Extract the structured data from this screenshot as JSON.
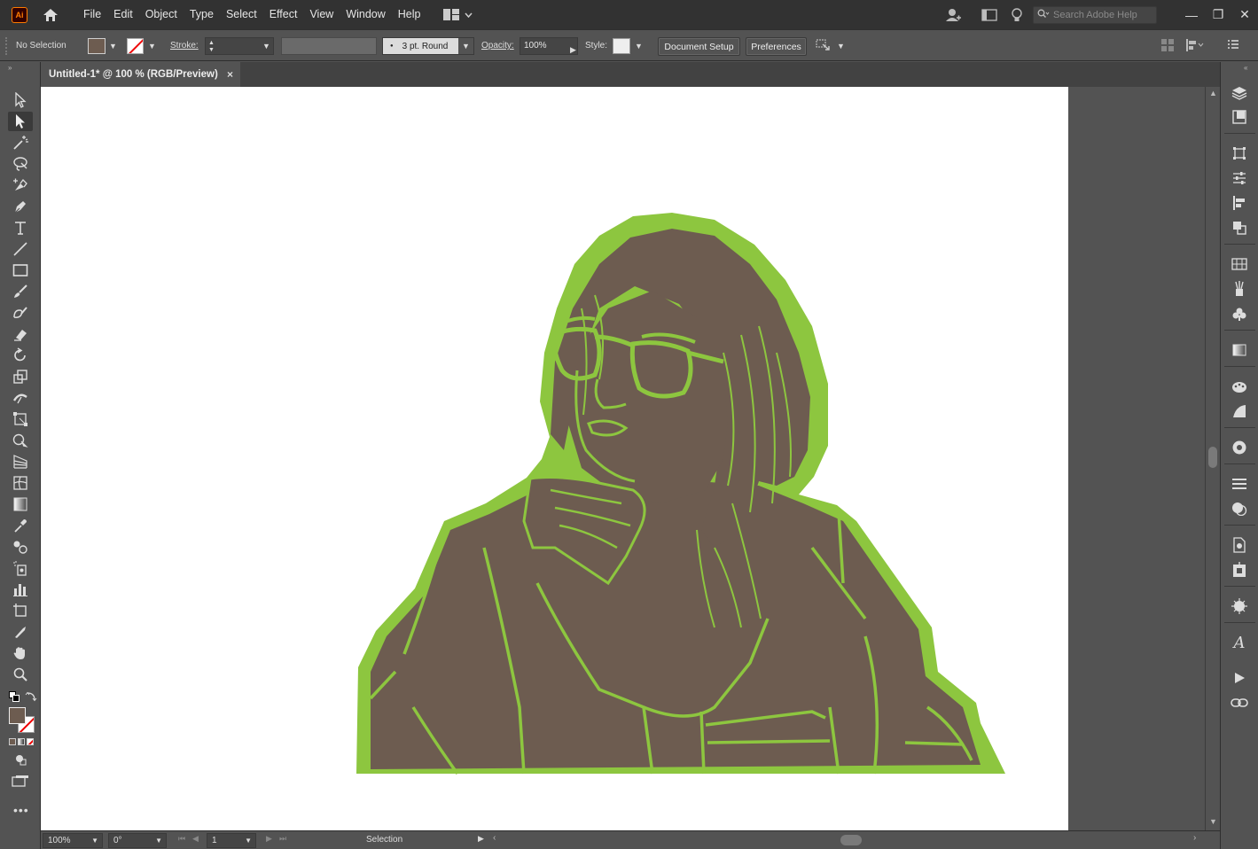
{
  "app": {
    "logo": "Ai",
    "menu": [
      "File",
      "Edit",
      "Object",
      "Type",
      "Select",
      "Effect",
      "View",
      "Window",
      "Help"
    ],
    "search_placeholder": "Search Adobe Help"
  },
  "control_bar": {
    "selection_label": "No Selection",
    "stroke_label": "Stroke:",
    "brush_label": "3 pt. Round",
    "opacity_label": "Opacity:",
    "opacity_value": "100%",
    "style_label": "Style:",
    "document_setup": "Document Setup",
    "preferences": "Preferences"
  },
  "document_tab": {
    "title": "Untitled-1* @ 100 % (RGB/Preview)",
    "close": "×"
  },
  "status_bar": {
    "zoom": "100%",
    "rotation": "0°",
    "artboard": "1",
    "tool": "Selection"
  },
  "colors": {
    "fill": "#6d5c50",
    "stroke_art": "#8dc63f",
    "artboard": "#ffffff"
  },
  "icons": {
    "home": "home-icon",
    "workspace": "workspace-switcher-icon",
    "account": "account-icon",
    "arrange": "arrange-documents-icon",
    "discover": "lightbulb-icon",
    "search": "search-icon"
  }
}
